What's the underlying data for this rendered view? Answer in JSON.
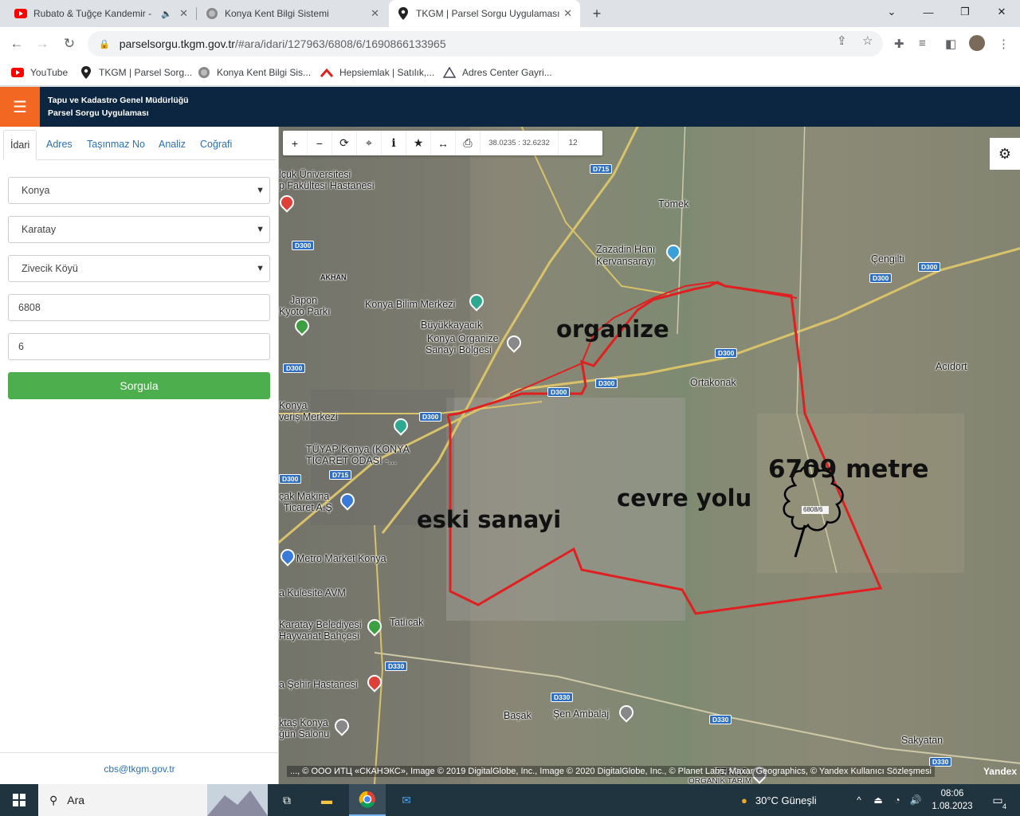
{
  "browser": {
    "tabs": [
      {
        "title": "Rubato & Tuğçe Kandemir - ",
        "icon": "youtube-icon"
      },
      {
        "title": "Konya Kent Bilgi Sistemi",
        "icon": "seal-icon"
      },
      {
        "title": "TKGM | Parsel Sorgu Uygulaması",
        "icon": "location-pin-icon"
      }
    ],
    "url_host": "parselsorgu.tkgm.gov.tr",
    "url_path": "/#ara/idari/127963/6808/6/1690866133965",
    "bookmarks": [
      {
        "label": "YouTube",
        "icon": "youtube-icon"
      },
      {
        "label": "TKGM | Parsel Sorg...",
        "icon": "location-pin-icon"
      },
      {
        "label": "Konya Kent Bilgi Sis...",
        "icon": "seal-icon"
      },
      {
        "label": "Hepsiemlak | Satılık,...",
        "icon": "hepsiemlak-icon"
      },
      {
        "label": "Adres Center Gayri...",
        "icon": "adres-icon"
      }
    ]
  },
  "app": {
    "title_line1": "Tapu ve Kadastro Genel Müdürlüğü",
    "title_line2": "Parsel Sorgu Uygulaması"
  },
  "sidebar": {
    "tabs": [
      "İdari",
      "Adres",
      "Taşınmaz No",
      "Analiz",
      "Coğrafi"
    ],
    "il": "Konya",
    "ilce": "Karatay",
    "mahalle": "Zivecik Köyü",
    "ada": "6808",
    "parsel": "6",
    "query_button": "Sorgula",
    "email": "cbs@tkgm.gov.tr"
  },
  "map": {
    "coords": "38.0235 : 32.6232",
    "zoom": "12",
    "annotations": {
      "organize": "organize",
      "cevre_yolu": "cevre yolu",
      "eski_sanayi": "eski sanayi",
      "distance": "6709 metre"
    },
    "parcel_label": "6808/6",
    "places": [
      "lçuk Üniversitesi",
      "p Fakültesi Hastanesi",
      "Tömek",
      "Zazadin Hanı",
      "Kervansarayı",
      "Çengilti",
      "AKHAN",
      "Japon",
      "Kyoto Parkı",
      "Konya Bilim Merkezi",
      "Büyükkayacık",
      "Konya Organize",
      "Sanayi Bölgesi",
      "Acıdort",
      "Ortakonak",
      "Konya",
      "veriş Merkezi",
      "TÜYAP Konya (KONYA",
      "TİCARET ODASI -...",
      "çak Makina",
      "Ticaret A.Ş",
      "Metro Market Konya",
      "a Kulesite AVM",
      "Karatay Belediyesi",
      "Hayvanat Bahçesi",
      "Tatlıcak",
      "a Şehir Hastanesi",
      "Başak",
      "Şen Ambalaj",
      "ktaş Konya",
      "ğün Salonu",
      "Sakyatan",
      "TEKNO",
      "ORGANİK TARIM"
    ],
    "roads": [
      "D715",
      "D300",
      "D300",
      "D300",
      "D300",
      "D300",
      "D300",
      "D300",
      "D715",
      "D330",
      "D330",
      "D330",
      "D330",
      "D300",
      "D300"
    ],
    "attribution": "..., © ООО ИТЦ «СКАНЭКС», Image © 2019 DigitalGlobe, Inc., Image © 2020 DigitalGlobe, Inc., © Planet Labs, Maxar Geographics, © Yandex Kullanıcı Sözleşmesi",
    "yandex": "Yandex"
  },
  "taskbar": {
    "search_placeholder": "Ara",
    "weather": "30°C  Güneşli",
    "time": "08:06",
    "date": "1.08.2023",
    "notifications": "4"
  }
}
